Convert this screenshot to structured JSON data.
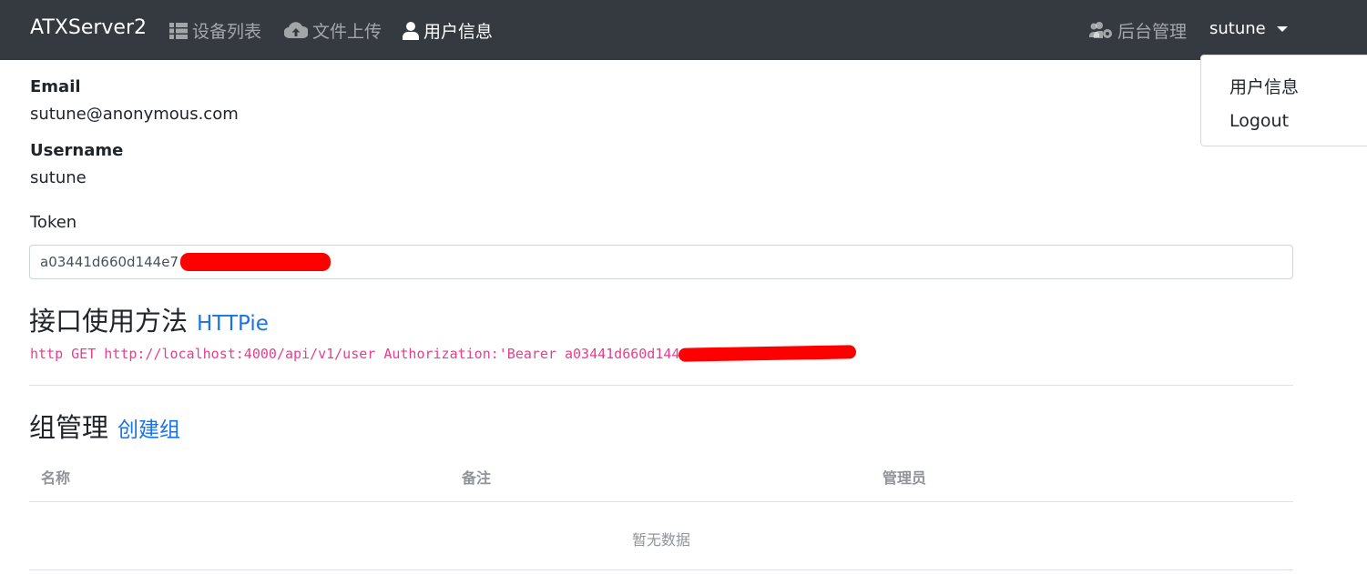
{
  "navbar": {
    "brand": "ATXServer2",
    "items": [
      {
        "label": "设备列表",
        "icon": "list-icon"
      },
      {
        "label": "文件上传",
        "icon": "cloud-upload-icon"
      },
      {
        "label": "用户信息",
        "icon": "user-icon"
      }
    ],
    "admin": {
      "label": "后台管理",
      "icon": "users-cog-icon"
    },
    "user": "sutune"
  },
  "dropdown": {
    "items": [
      "用户信息",
      "Logout"
    ]
  },
  "profile": {
    "email_label": "Email",
    "email": "sutune@anonymous.com",
    "username_label": "Username",
    "username": "sutune",
    "token_label": "Token",
    "token": "a03441d660d144e7"
  },
  "api": {
    "title": "接口使用方法",
    "link": "HTTPie",
    "command": "http GET http://localhost:4000/api/v1/user Authorization:'Bearer a03441d660d144e7f2945e92a954b530'"
  },
  "groups": {
    "title": "组管理",
    "create_link": "创建组",
    "columns": [
      "名称",
      "备注",
      "管理员"
    ],
    "empty_text": "暂无数据"
  },
  "colors": {
    "navbar_bg": "#343a40",
    "link": "#1a73e8",
    "code": "#e83e8c",
    "redaction": "#ff0000"
  }
}
